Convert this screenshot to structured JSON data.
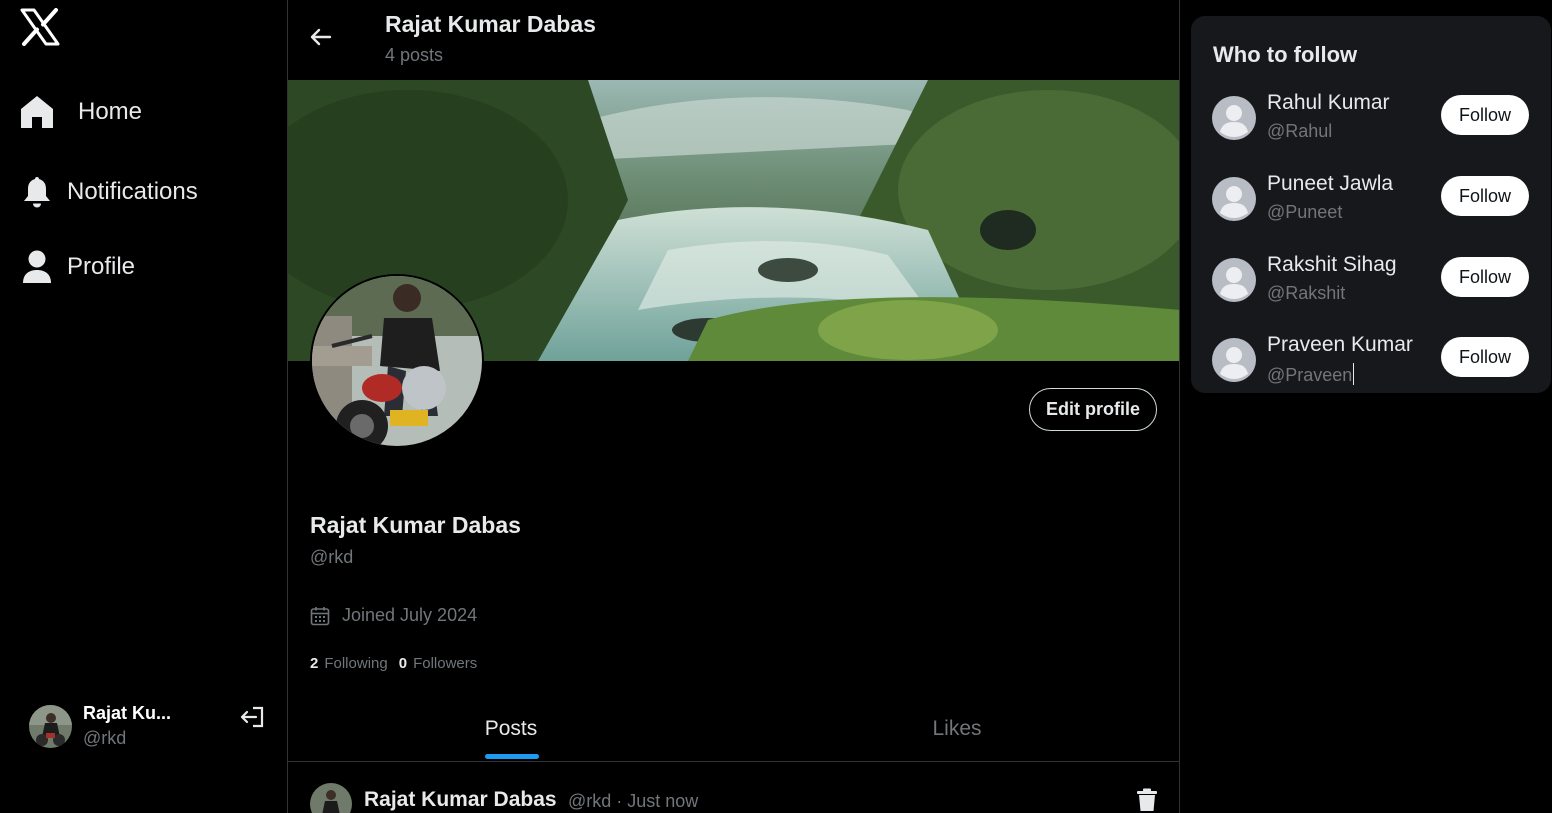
{
  "sidebar": {
    "nav": [
      {
        "label": "Home",
        "icon": "home-icon"
      },
      {
        "label": "Notifications",
        "icon": "bell-icon"
      },
      {
        "label": "Profile",
        "icon": "user-icon"
      }
    ],
    "account": {
      "name": "Rajat Ku...",
      "handle": "@rkd"
    }
  },
  "header": {
    "name": "Rajat Kumar Dabas",
    "posts": "4 posts"
  },
  "profile": {
    "name": "Rajat Kumar Dabas",
    "handle": "@rkd",
    "joined": "Joined July 2024",
    "following_count": "2",
    "following_label": "Following",
    "followers_count": "0",
    "followers_label": "Followers",
    "edit_label": "Edit profile"
  },
  "tabs": [
    {
      "label": "Posts",
      "active": true
    },
    {
      "label": "Likes",
      "active": false
    }
  ],
  "post": {
    "name": "Rajat Kumar Dabas",
    "meta": "@rkd · Just now"
  },
  "who_to_follow": {
    "title": "Who to follow",
    "follow_label": "Follow",
    "users": [
      {
        "name": "Rahul Kumar",
        "handle": "@Rahul"
      },
      {
        "name": "Puneet Jawla",
        "handle": "@Puneet"
      },
      {
        "name": "Rakshit Sihag",
        "handle": "@Rakshit"
      },
      {
        "name": "Praveen Kumar",
        "handle": "@Praveen"
      }
    ]
  },
  "colors": {
    "background": "#000000",
    "accent": "#1d9bf0",
    "muted": "#71767b",
    "panel": "#16181c"
  }
}
